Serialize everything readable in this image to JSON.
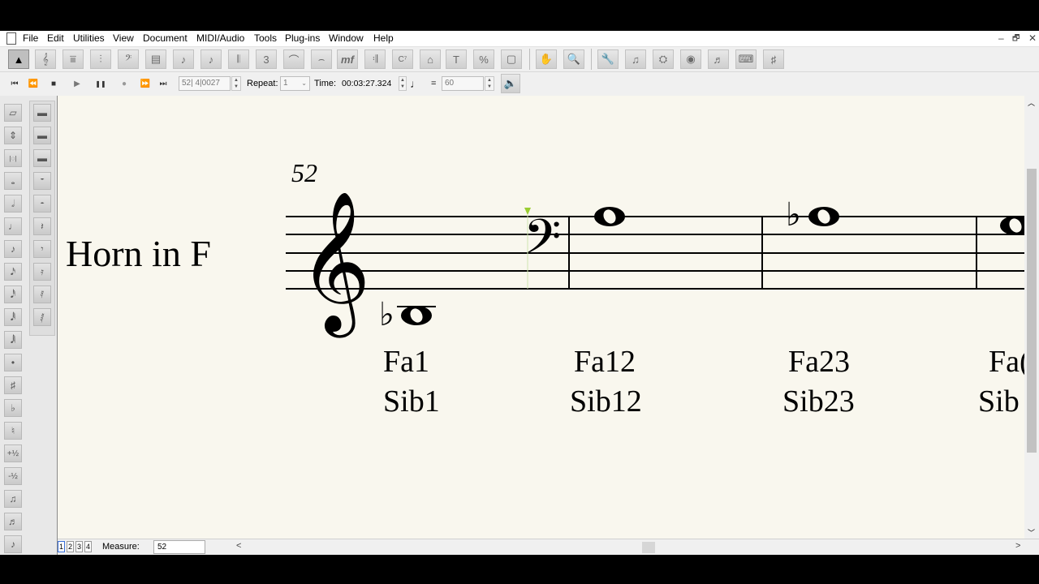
{
  "menu": [
    "File",
    "Edit",
    "Utilities",
    "View",
    "Document",
    "MIDI/Audio",
    "Tools",
    "Plug-ins",
    "Window",
    "Help"
  ],
  "window_controls": [
    "–",
    "🗗",
    "✕"
  ],
  "toolbar_main": {
    "selection_tool": "▲",
    "tools_left": [
      "𝄞",
      "⩸",
      "⫶",
      "𝄢",
      "▤",
      "♪",
      "♪",
      "𝄃",
      "3",
      "⌒",
      "⌢",
      "mf",
      "𝄇",
      "C⁷",
      "⌂",
      "T",
      "%",
      "▢"
    ],
    "tools_right": [
      "✋",
      "🔍",
      "🔧",
      "♫",
      "⛭",
      "◉",
      "♬",
      "⌨",
      "♯"
    ]
  },
  "playback": {
    "buttons": [
      "⏮",
      "⏪",
      "■",
      "▶",
      "❚❚",
      "●",
      "⏩",
      "⏭"
    ],
    "measure_counter": "52| 4|0027",
    "repeat_label": "Repeat:",
    "repeat_value": "1",
    "time_label": "Time:",
    "time_value": "00:03:27.324",
    "equals": "=",
    "tempo_value": "60"
  },
  "palette": {
    "left": [
      "▱",
      "⇕",
      "|◌|",
      "𝅝",
      "𝅗𝅥",
      "♩",
      "♪",
      "𝅘𝅥𝅯",
      "𝅘𝅥𝅰",
      "𝅘𝅥𝅱",
      "𝅘𝅥𝅲",
      "•",
      "♯",
      "♭",
      "♮",
      "+½",
      "-½",
      "♫",
      "♬",
      "♪"
    ],
    "right": [
      "▬",
      "▬",
      "▬",
      "𝄻",
      "𝄼",
      "𝄽",
      "𝄾",
      "𝄿",
      "𝅀",
      "𝅁"
    ]
  },
  "score": {
    "measure_number": "52",
    "instrument": "Horn in F",
    "syllables": [
      {
        "top": "Fa1",
        "bottom": "Sib1"
      },
      {
        "top": "Fa12",
        "bottom": "Sib12"
      },
      {
        "top": "Fa23",
        "bottom": "Sib23"
      },
      {
        "top": "Fa(",
        "bottom": "Sib"
      }
    ]
  },
  "statusbar": {
    "pages": [
      "1",
      "2",
      "3",
      "4"
    ],
    "measure_label": "Measure:",
    "measure_value": "52"
  }
}
